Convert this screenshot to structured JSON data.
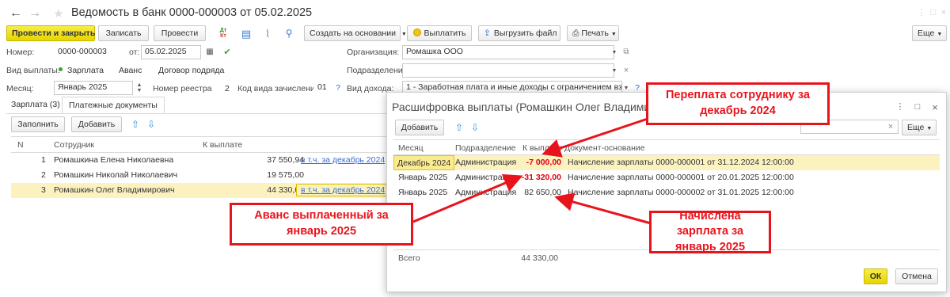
{
  "window": {
    "title": "Ведомость в банк 0000-000003 от 05.02.2025",
    "back_glyph": "←",
    "forward_glyph": "→",
    "star_glyph": "★"
  },
  "toolbar": {
    "post_close": "Провести и закрыть",
    "save": "Записать",
    "post": "Провести",
    "create_based": "Создать на основании",
    "pay": "Выплатить",
    "upload": "Выгрузить файл",
    "print": "Печать",
    "more": "Еще"
  },
  "form": {
    "number_label": "Номер:",
    "number_value": "0000-000003",
    "from_label": "от:",
    "date_value": "05.02.2025",
    "org_label": "Организация:",
    "org_value": "Ромашка ООО",
    "payment_type_label": "Вид выплаты:",
    "payment_type_options": [
      "Зарплата",
      "Аванс",
      "Договор подряда"
    ],
    "department_label": "Подразделение:",
    "department_value": "",
    "month_label": "Месяц:",
    "month_value": "Январь 2025",
    "registry_label": "Номер реестра",
    "registry_value": "2",
    "credit_code_label": "Код вида зачисления",
    "credit_code_value": "01",
    "income_label": "Вид дохода:",
    "income_value": "1 - Заработная плата и иные доходы с ограничением взыскан",
    "help_glyph": "?"
  },
  "tabs": [
    "Зарплата (3)",
    "Платежные документы"
  ],
  "table_toolbar": {
    "fill": "Заполнить",
    "add": "Добавить"
  },
  "table": {
    "headers": [
      "N",
      "Сотрудник",
      "К выплате"
    ],
    "rows": [
      {
        "n": "1",
        "employee": "Ромашкина Елена Николаевна",
        "amount": "37 550,94",
        "link": "в т.ч. за декабрь 2024"
      },
      {
        "n": "2",
        "employee": "Ромашкин Николай Николаевич",
        "amount": "19 575,00",
        "link": ""
      },
      {
        "n": "3",
        "employee": "Ромашкин Олег Владимирович",
        "amount": "44 330,00",
        "link": "в т.ч. за декабрь 2024"
      }
    ]
  },
  "dialog": {
    "title": "Расшифровка выплаты (Ромашкин Олег Владимирович)",
    "add": "Добавить",
    "more": "Еще",
    "headers": [
      "Месяц",
      "Подразделение",
      "К выплате",
      "Документ-основание"
    ],
    "rows": [
      {
        "month": "Декабрь 2024",
        "dept": "Администрация",
        "amount": "-7 000,00",
        "doc": "Начисление зарплаты 0000-000001 от 31.12.2024 12:00:00"
      },
      {
        "month": "Январь 2025",
        "dept": "Администрация",
        "amount": "-31 320,00",
        "doc": "Начисление зарплаты 0000-000001 от 20.01.2025 12:00:00"
      },
      {
        "month": "Январь 2025",
        "dept": "Администрация",
        "amount": "82 650,00",
        "doc": "Начисление зарплаты 0000-000002 от 31.01.2025 12:00:00"
      }
    ],
    "total_label": "Всего",
    "total_value": "44 330,00",
    "ok": "ОК",
    "cancel": "Отмена"
  },
  "annotations": {
    "overpayment": "Переплата сотруднику за декабрь 2024",
    "advance": "Аванс выплаченный за январь 2025",
    "accrued": "Начислена зарплата за январь 2025"
  },
  "colors": {
    "accent_yellow": "#f3e11c",
    "annotation_red": "#e8141c",
    "row_highlight": "#fbf2c0",
    "link_blue": "#3a6ecf"
  }
}
